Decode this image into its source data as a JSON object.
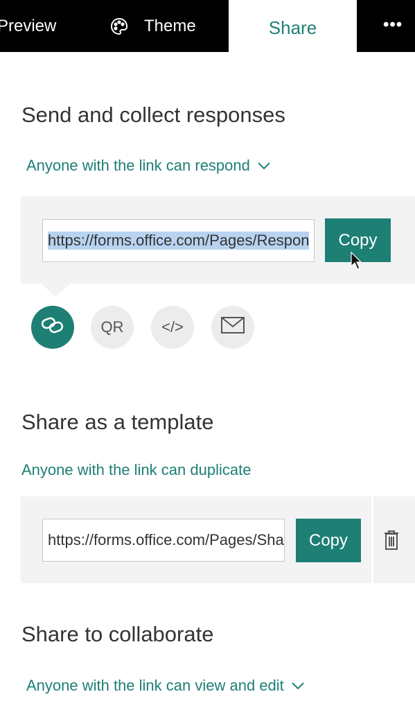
{
  "tabs": {
    "preview": "Preview",
    "theme": "Theme",
    "share": "Share",
    "more": "•••"
  },
  "send": {
    "title": "Send and collect responses",
    "permission": "Anyone with the link can respond",
    "url": "https://forms.office.com/Pages/Respon",
    "copy_label": "Copy",
    "options": [
      {
        "icon": "link-icon",
        "label": ""
      },
      {
        "icon": "qr-icon",
        "label": "QR"
      },
      {
        "icon": "embed-icon",
        "label": "</>"
      },
      {
        "icon": "mail-icon",
        "label": ""
      }
    ]
  },
  "template": {
    "title": "Share as a template",
    "permission": "Anyone with the link can duplicate",
    "url": "https://forms.office.com/Pages/Sha",
    "copy_label": "Copy"
  },
  "collaborate": {
    "title": "Share to collaborate",
    "permission": "Anyone with the link can view and edit"
  },
  "colors": {
    "accent": "#1e7f74",
    "topbar": "#000000",
    "panel": "#f3f3f3"
  }
}
